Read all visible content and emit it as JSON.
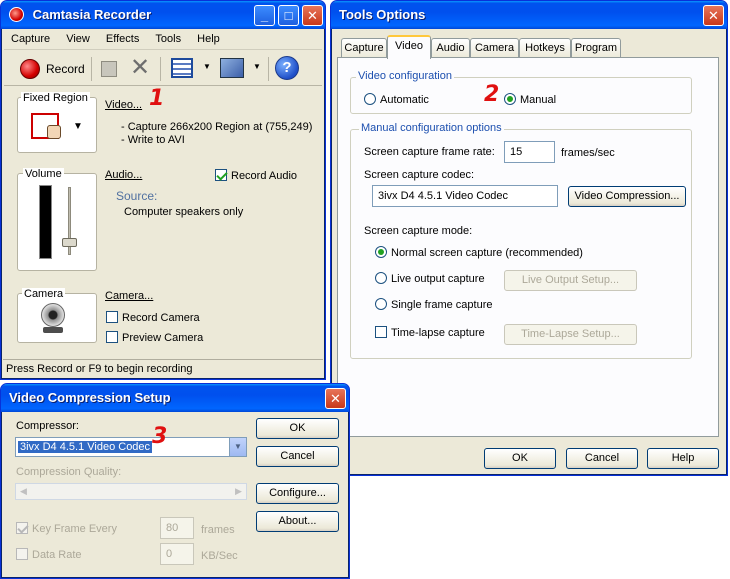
{
  "recorder": {
    "title": "Camtasia Recorder",
    "menu": [
      "Capture",
      "View",
      "Effects",
      "Tools",
      "Help"
    ],
    "record_label": "Record",
    "fixed_region_label": "Fixed Region",
    "video_link": "Video...",
    "capture_info": "- Capture 266x200 Region at (755,249)",
    "write_info": "- Write to AVI",
    "volume_label": "Volume",
    "audio_link": "Audio...",
    "record_audio": "Record Audio",
    "source_label": "Source:",
    "source_value": "Computer speakers only",
    "camera_label": "Camera",
    "camera_link": "Camera...",
    "record_camera": "Record Camera",
    "preview_camera": "Preview Camera",
    "status": "Press Record or F9 to begin recording"
  },
  "tools": {
    "title": "Tools Options",
    "tabs": [
      "Capture",
      "Video",
      "Audio",
      "Camera",
      "Hotkeys",
      "Program"
    ],
    "video_config_label": "Video configuration",
    "automatic": "Automatic",
    "manual": "Manual",
    "manual_options_label": "Manual configuration options",
    "frame_rate_label": "Screen capture frame rate:",
    "frame_rate_value": "15",
    "frame_rate_unit": "frames/sec",
    "codec_label": "Screen capture codec:",
    "codec_value": "3ivx D4 4.5.1 Video Codec",
    "video_compression_btn": "Video Compression...",
    "mode_label": "Screen capture mode:",
    "mode_normal": "Normal screen capture (recommended)",
    "mode_live": "Live output capture",
    "live_setup_btn": "Live Output Setup...",
    "mode_single": "Single frame capture",
    "mode_timelapse": "Time-lapse capture",
    "timelapse_setup_btn": "Time-Lapse Setup...",
    "ok": "OK",
    "cancel": "Cancel",
    "help": "Help"
  },
  "compression": {
    "title": "Video Compression Setup",
    "compressor_label": "Compressor:",
    "compressor_value": "3ivx D4 4.5.1 Video Codec",
    "quality_label": "Compression Quality:",
    "keyframe_label": "Key Frame Every",
    "keyframe_value": "80",
    "keyframe_unit": "frames",
    "datarate_label": "Data Rate",
    "datarate_value": "0",
    "datarate_unit": "KB/Sec",
    "ok": "OK",
    "cancel": "Cancel",
    "configure": "Configure...",
    "about": "About..."
  },
  "annotations": {
    "n1": "1",
    "n2": "2",
    "n3": "3"
  }
}
